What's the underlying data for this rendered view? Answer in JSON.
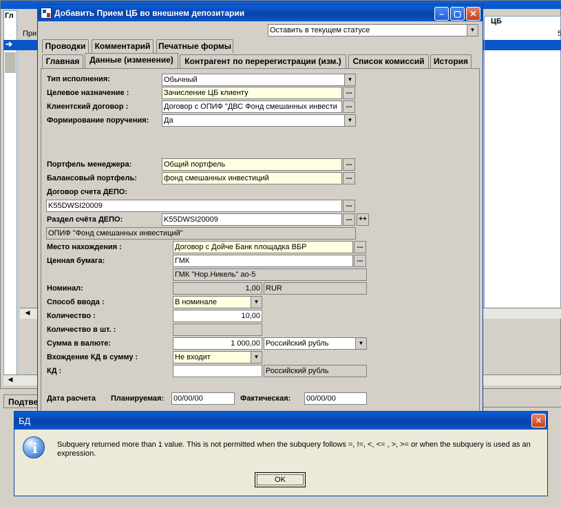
{
  "bg_window": {
    "col_header_left": "Гл",
    "col_header_cb": "ЦБ",
    "row1_text": "При",
    "row_right_digit": "5",
    "status_tab": "Подтве"
  },
  "form": {
    "title": "Добавить Прием ЦБ во внешнем депозитарии",
    "status_select": "Оставить в текущем статусе",
    "tabs_row1": [
      "Проводки",
      "Комментарий",
      "Печатные формы"
    ],
    "tabs_row2": [
      "Главная",
      "Данные (изменение)",
      "Контрагент по перерегистрации (изм.)",
      "Список комиссий",
      "История"
    ],
    "labels": {
      "exec_type": "Тип исполнения:",
      "purpose": "Целевое назначение :",
      "client_contract": "Клиентский договор :",
      "order_forming": "Формирование поручения:",
      "manager_portfolio": "Портфель менеджера:",
      "balance_portfolio": "Балансовый портфель:",
      "depo_contract": "Договор счета ДЕПО:",
      "depo_section": "Раздел счёта ДЕПО:",
      "location": "Место нахождения :",
      "security": "Ценная бумага:",
      "nominal": "Номинал:",
      "input_method": "Способ ввода :",
      "quantity": "Количество :",
      "quantity_pcs": "Количество в шт. :",
      "amount_currency": "Сумма в валюте:",
      "kd_included": "Вхождение КД в сумму :",
      "kd": "КД :",
      "settle_date": "Дата расчета",
      "planned": "Планируемая:",
      "actual": "Фактическая:"
    },
    "values": {
      "exec_type": "Обычный",
      "purpose": "Зачисление ЦБ клиенту",
      "client_contract": "Договор с ОПИФ \"ДВС Фонд смешанных инвести",
      "order_forming": "Да",
      "manager_portfolio": "Общий портфель",
      "balance_portfolio": "фонд смешанных инвестиций",
      "depo_contract": "K55DWSI20009",
      "depo_section": "K55DWSI20009",
      "depo_owner": "ОПИФ \"Фонд смешанных инвестиций\"",
      "location": "Договор с Дойче Банк площадка ВБР",
      "security": "ГМК",
      "security_full": "ГМК \"Нор.Никель\" ао-5",
      "nominal": "1,00",
      "nominal_currency": "RUR",
      "input_method": "В номинале",
      "quantity": "10,00",
      "quantity_pcs": "",
      "amount": "1 000,00",
      "amount_currency": "Российский рубль",
      "kd_included": "Не входит",
      "kd": "",
      "kd_currency": "Российский рубль",
      "planned_date": "00/00/00",
      "actual_date": "00/00/00"
    },
    "ellipsis": "...",
    "plusplus": "++"
  },
  "dialog": {
    "title": "БД",
    "message": "Subquery returned more than 1 value. This is not permitted when the subquery follows =, !=, <, <= , >, >= or when the subquery is used as an expression.",
    "ok_label": "OK"
  },
  "colors": {
    "window_bg": "#d4d0c8",
    "titlebar": "#0a56c8",
    "field_yellow": "#ffffe1",
    "selected_row": "#0a56c8"
  }
}
